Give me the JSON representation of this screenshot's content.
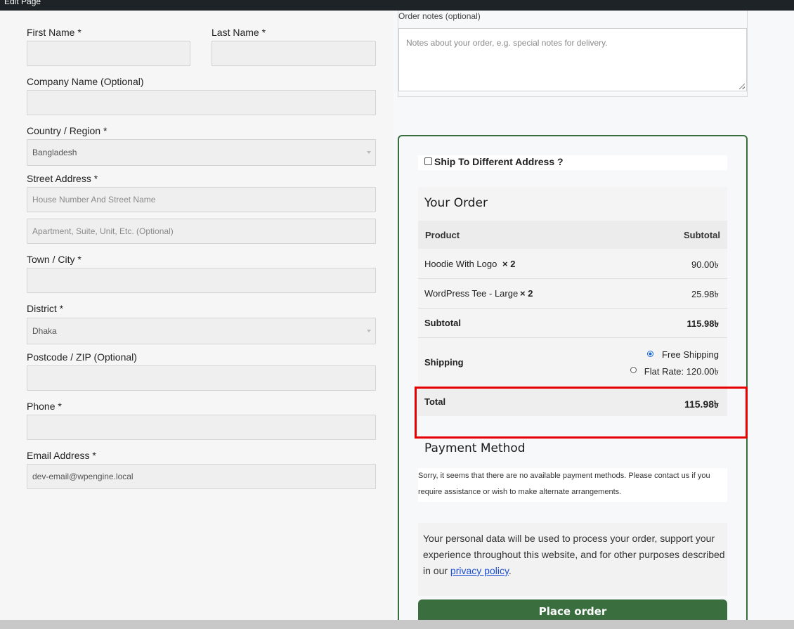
{
  "adminbar": {
    "edit_page": "Edit Page"
  },
  "billing": {
    "first_name_label": "First Name",
    "last_name_label": "Last Name",
    "company_label": "Company Name (Optional)",
    "country_label": "Country / Region",
    "country_value": "Bangladesh",
    "street_label": "Street Address",
    "street_placeholder": "House Number And Street Name",
    "apartment_placeholder": "Apartment, Suite, Unit, Etc. (Optional)",
    "town_label": "Town / City",
    "district_label": "District",
    "district_value": "Dhaka",
    "postcode_label": "Postcode / ZIP (Optional)",
    "phone_label": "Phone",
    "email_label": "Email Address",
    "email_value": "dev-email@wpengine.local",
    "required_mark": "*"
  },
  "notes": {
    "label": "Order notes (optional)",
    "placeholder": "Notes about your order, e.g. special notes for delivery."
  },
  "ship_different": "Ship To Different Address ?",
  "order": {
    "title": "Your Order",
    "col_product": "Product",
    "col_subtotal": "Subtotal",
    "items": [
      {
        "name": "Hoodie With Logo",
        "qty": "× 2",
        "price": "90.00৳"
      },
      {
        "name": "WordPress Tee - Large",
        "qty": "× 2",
        "price": "25.98৳"
      }
    ],
    "subtotal_label": "Subtotal",
    "subtotal_value": "115.98৳",
    "shipping_label": "Shipping",
    "shipping_options": [
      {
        "label": "Free Shipping",
        "selected": true
      },
      {
        "label": "Flat Rate: 120.00৳",
        "selected": false
      }
    ],
    "total_label": "Total",
    "total_value": "115.98৳"
  },
  "payment": {
    "title": "Payment Method",
    "note": "Sorry, it seems that there are no available payment methods. Please contact us if you require assistance or wish to make alternate arrangements."
  },
  "privacy": {
    "text_before": "Your personal data will be used to process your order, support your experience throughout this website, and for other purposes described in our ",
    "link": "privacy policy",
    "text_after": "."
  },
  "place_order": "Place order",
  "colors": {
    "accent": "#3b6e3f",
    "highlight": "#e60000",
    "link": "#1a4fd4"
  }
}
